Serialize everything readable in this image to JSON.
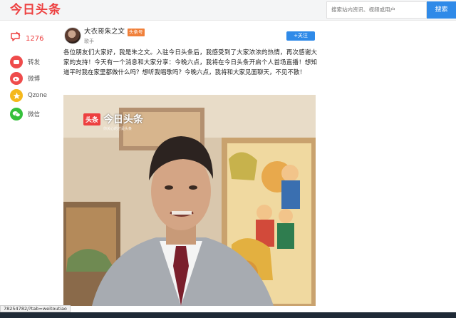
{
  "header": {
    "logo": "今日头条",
    "search_placeholder": "搜索站内资讯、视频或用户",
    "search_button": "搜索"
  },
  "sidebar": {
    "comment_count": "1276",
    "items": [
      {
        "label": "转发",
        "icon": "repost-icon",
        "color": "#ef4b4b"
      },
      {
        "label": "微博",
        "icon": "weibo-icon",
        "color": "#ef4b4b"
      },
      {
        "label": "Qzone",
        "icon": "qzone-icon",
        "color": "#f5b81c"
      },
      {
        "label": "微信",
        "icon": "wechat-icon",
        "color": "#35c03b"
      }
    ]
  },
  "post": {
    "author": "大衣哥朱之文",
    "badge": "头条号",
    "role": "歌手",
    "follow_label": "+关注",
    "text": "各位朋友们大家好，我是朱之文。入驻今日头条后，我感受到了大家浓浓的热情，再次感谢大家的支持！今天有一个消息和大家分享：今晚六点，我将在今日头条开启个人首场直播！想知道平时我在家里都做什么吗？想听我唱歌吗？今晚六点，我将和大家见面聊天，不见不散！",
    "image_watermark": {
      "badge": "头条",
      "title": "今日头条",
      "subtitle": "你关心的才是头条"
    }
  },
  "status_bar": {
    "url": "78254782/?tab=weitoutiao"
  },
  "colors": {
    "brand_red": "#ed4040",
    "link_blue": "#2f8ae8",
    "badge_orange": "#f0803a"
  }
}
